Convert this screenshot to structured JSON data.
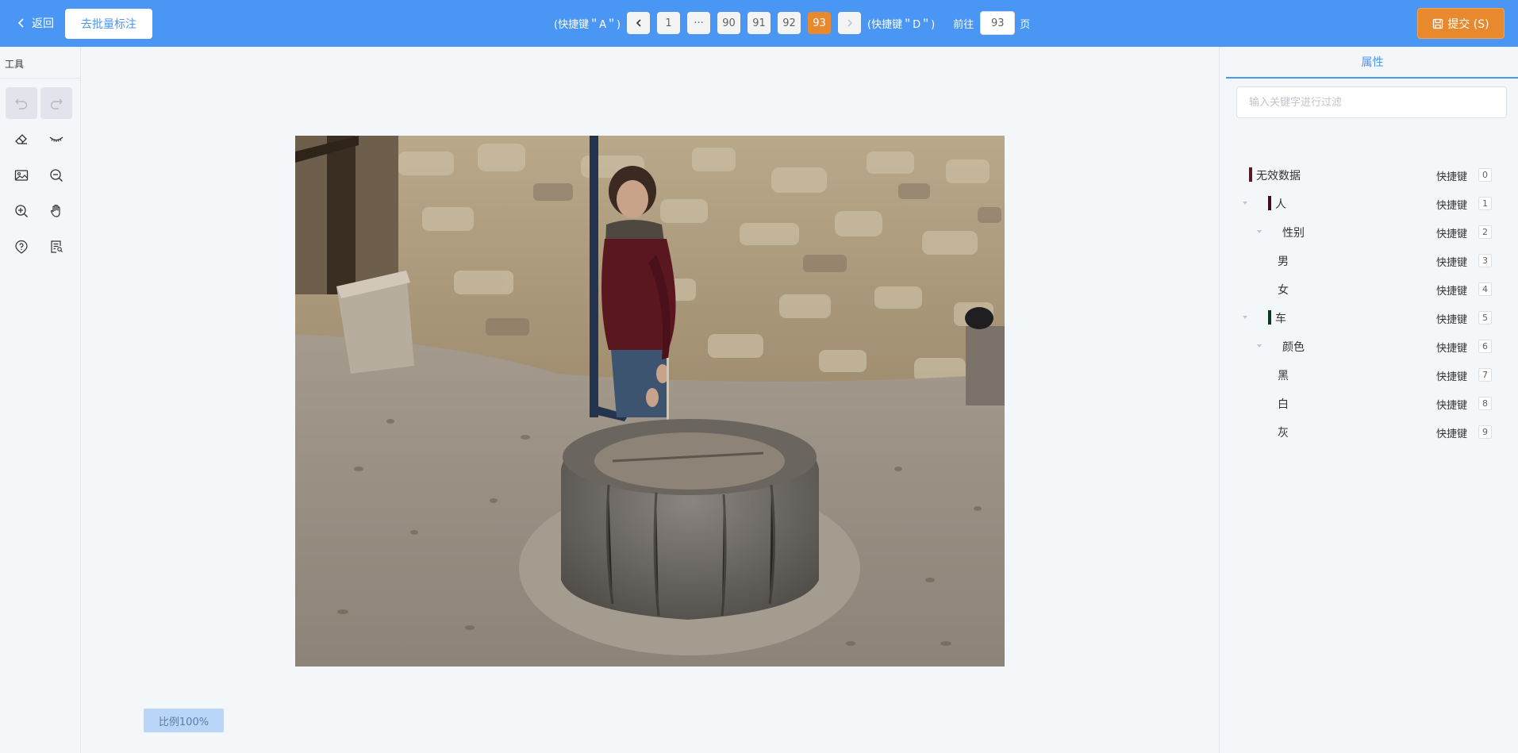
{
  "header": {
    "back_label": "返回",
    "batch_label": "去批量标注",
    "prev_hint": "(快捷键＂A＂)",
    "next_hint": "(快捷键＂D＂)",
    "pages": [
      "1",
      "···",
      "90",
      "91",
      "92",
      "93"
    ],
    "active_page": "93",
    "goto_label": "前往",
    "goto_value": "93",
    "goto_suffix": "页",
    "submit_label": "提交 (S)"
  },
  "tools": {
    "title": "工具",
    "items": [
      {
        "icon": "undo-icon",
        "disabled": true
      },
      {
        "icon": "redo-icon",
        "disabled": true
      },
      {
        "icon": "eraser-icon",
        "disabled": false
      },
      {
        "icon": "eye-closed-icon",
        "disabled": false
      },
      {
        "icon": "image-icon",
        "disabled": false
      },
      {
        "icon": "zoom-out-icon",
        "disabled": false
      },
      {
        "icon": "zoom-in-icon",
        "disabled": false
      },
      {
        "icon": "hand-icon",
        "disabled": false
      },
      {
        "icon": "help-icon",
        "disabled": false
      },
      {
        "icon": "notes-icon",
        "disabled": false
      }
    ]
  },
  "canvas": {
    "scale_label": "比例100%"
  },
  "panel": {
    "tab_label": "属性",
    "filter_placeholder": "输入关键字进行过滤",
    "shortcut_label": "快捷键",
    "items": [
      {
        "label": "无效数据",
        "key": "0",
        "level": 0,
        "expand": false,
        "color": "#5a1a1f"
      },
      {
        "label": "人",
        "key": "1",
        "level": 0,
        "expand": true,
        "color": "#4a0d18"
      },
      {
        "label": "性别",
        "key": "2",
        "level": 1,
        "expand": true,
        "color": null
      },
      {
        "label": "男",
        "key": "3",
        "level": 2,
        "expand": false,
        "color": null
      },
      {
        "label": "女",
        "key": "4",
        "level": 2,
        "expand": false,
        "color": null
      },
      {
        "label": "车",
        "key": "5",
        "level": 0,
        "expand": true,
        "color": "#0d3a1a"
      },
      {
        "label": "颜色",
        "key": "6",
        "level": 1,
        "expand": true,
        "color": null
      },
      {
        "label": "黑",
        "key": "7",
        "level": 2,
        "expand": false,
        "color": null
      },
      {
        "label": "白",
        "key": "8",
        "level": 2,
        "expand": false,
        "color": null
      },
      {
        "label": "灰",
        "key": "9",
        "level": 2,
        "expand": false,
        "color": null
      }
    ]
  }
}
